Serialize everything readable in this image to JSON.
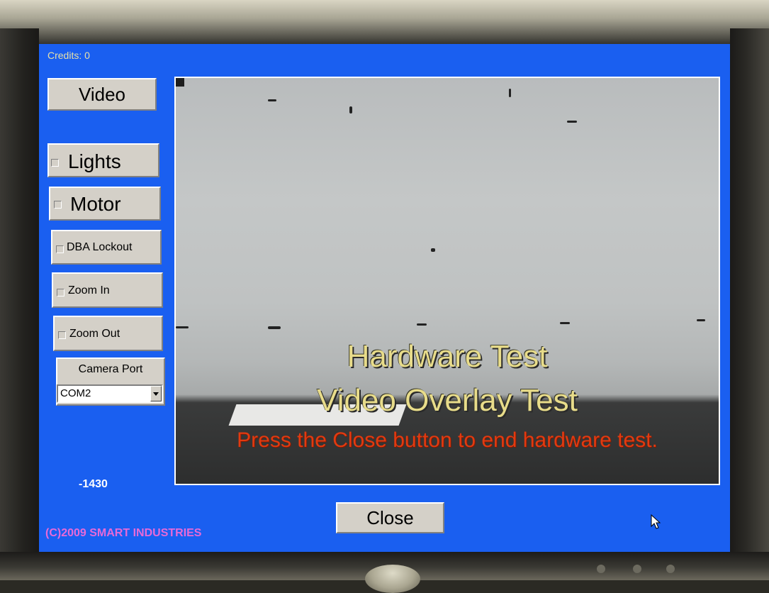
{
  "header": {
    "credits": "Credits: 0"
  },
  "sidebar": {
    "video_label": "Video",
    "toggles": [
      {
        "label": "Lights"
      },
      {
        "label": "Motor"
      },
      {
        "label": "DBA Lockout"
      },
      {
        "label": "Zoom In"
      },
      {
        "label": "Zoom Out"
      }
    ],
    "camera_port": {
      "label": "Camera Port",
      "selected": "COM2"
    },
    "counter": "-1430"
  },
  "overlay": {
    "title": "Hardware Test",
    "subtitle": "Video Overlay Test",
    "instruction": "Press the Close button to end hardware test."
  },
  "footer": {
    "close_label": "Close",
    "copyright": "(C)2009 SMART INDUSTRIES"
  },
  "colors": {
    "screen_bg": "#1a5ff0",
    "overlay_title": "#e8dc8a",
    "overlay_warning": "#e23a10",
    "copyright": "#e76ad8",
    "credits": "#e7e0a8"
  },
  "icons": [
    "dropdown-arrow-icon",
    "mouse-pointer-icon"
  ]
}
